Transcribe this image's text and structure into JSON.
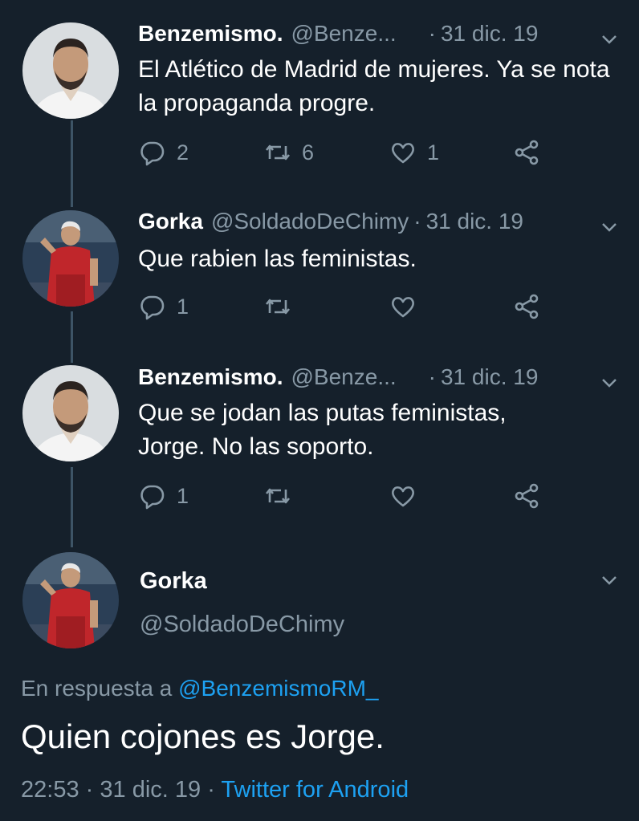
{
  "colors": {
    "background": "#15202b",
    "text_primary": "#ffffff",
    "text_secondary": "#8899a6",
    "link": "#1da1f2",
    "thread_line": "#3d5466"
  },
  "thread": [
    {
      "name": "Benzemismo.",
      "handle": "@Benze...",
      "date": "31 dic. 19",
      "text": "El Atlético de Madrid de mujeres. Ya se nota la propaganda progre.",
      "replies": "2",
      "retweets": "6",
      "likes": "1",
      "avatar": "benzema-photo"
    },
    {
      "name": "Gorka",
      "handle": "@SoldadoDeChimy",
      "date": "31 dic. 19",
      "text": "Que rabien las feministas.",
      "replies": "1",
      "retweets": "",
      "likes": "",
      "avatar": "footballer-red-kit-photo"
    },
    {
      "name": "Benzemismo.",
      "handle": "@Benze...",
      "date": "31 dic. 19",
      "text": "Que se jodan las putas feministas, Jorge. No las soporto.",
      "replies": "1",
      "retweets": "",
      "likes": "",
      "avatar": "benzema-photo"
    }
  ],
  "main_tweet": {
    "name": "Gorka",
    "handle": "@SoldadoDeChimy",
    "reply_prefix": "En respuesta a",
    "reply_handle": "@BenzemismoRM_",
    "text": "Quien cojones es Jorge.",
    "time": "22:53",
    "date": "31 dic. 19",
    "separator": "·",
    "source": "Twitter for Android"
  },
  "icons": {
    "reply": "reply-icon",
    "retweet": "retweet-icon",
    "like": "heart-icon",
    "share": "share-icon",
    "more": "chevron-down-icon"
  }
}
